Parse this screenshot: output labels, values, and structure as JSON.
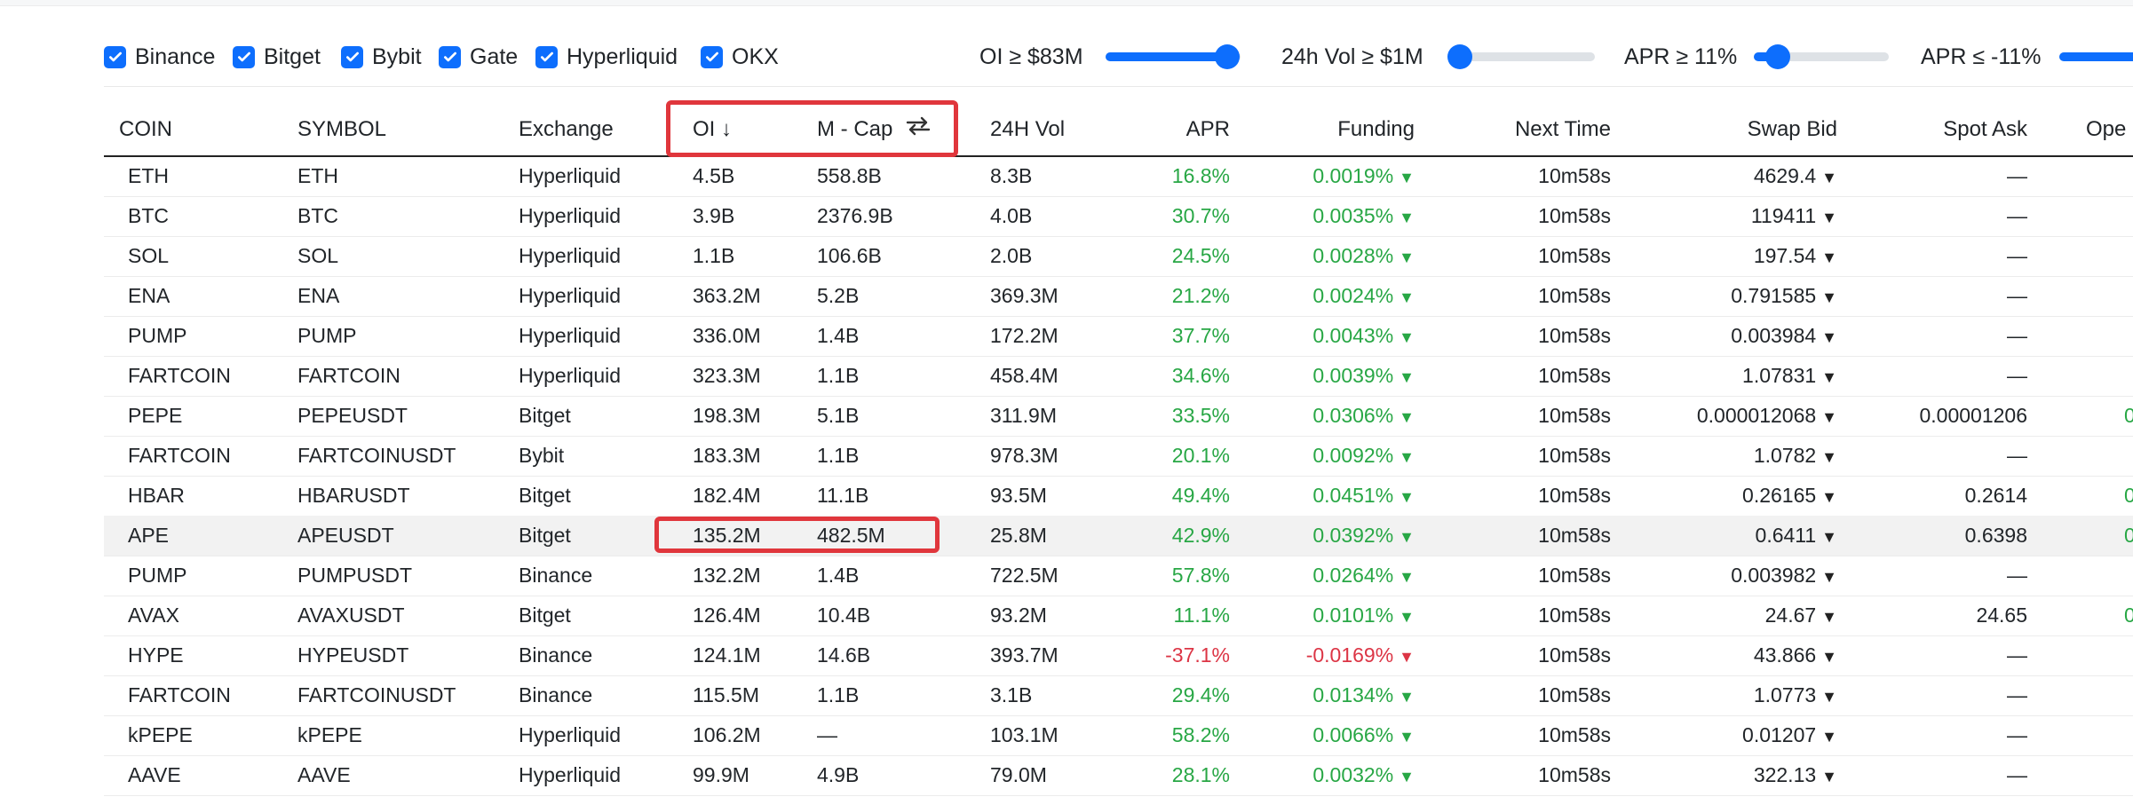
{
  "exchanges": [
    {
      "label": "Binance",
      "checked": true
    },
    {
      "label": "Bitget",
      "checked": true
    },
    {
      "label": "Bybit",
      "checked": true
    },
    {
      "label": "Gate",
      "checked": true
    },
    {
      "label": "Hyperliquid",
      "checked": true
    },
    {
      "label": "OKX",
      "checked": true
    }
  ],
  "filters": {
    "oi": {
      "label": "OI ≥ $83M",
      "level": 0.9
    },
    "vol": {
      "label": "24h Vol ≥ $1M",
      "level": 0.0
    },
    "apr_pos": {
      "label": "APR ≥ 11%",
      "level": 0.18
    },
    "apr_neg": {
      "label": "APR ≤ -11%",
      "level": 0.82
    }
  },
  "table": {
    "headers": {
      "coin": "COIN",
      "symbol": "SYMBOL",
      "exchange": "Exchange",
      "oi": "OI ↓",
      "mcap": "M - Cap",
      "vol": "24H Vol",
      "apr": "APR",
      "funding": "Funding",
      "next": "Next Time",
      "bid": "Swap Bid",
      "ask": "Spot Ask",
      "open": "Ope"
    },
    "rows": [
      {
        "coin": "ETH",
        "symbol": "ETH",
        "exchange": "Hyperliquid",
        "oi": "4.5B",
        "mcap": "558.8B",
        "vol": "8.3B",
        "apr": "16.8%",
        "funding": "0.0019%",
        "sign": "pos",
        "next": "10m58s",
        "bid": "4629.4",
        "ask": "—",
        "open": ""
      },
      {
        "coin": "BTC",
        "symbol": "BTC",
        "exchange": "Hyperliquid",
        "oi": "3.9B",
        "mcap": "2376.9B",
        "vol": "4.0B",
        "apr": "30.7%",
        "funding": "0.0035%",
        "sign": "pos",
        "next": "10m58s",
        "bid": "119411",
        "ask": "—",
        "open": ""
      },
      {
        "coin": "SOL",
        "symbol": "SOL",
        "exchange": "Hyperliquid",
        "oi": "1.1B",
        "mcap": "106.6B",
        "vol": "2.0B",
        "apr": "24.5%",
        "funding": "0.0028%",
        "sign": "pos",
        "next": "10m58s",
        "bid": "197.54",
        "ask": "—",
        "open": ""
      },
      {
        "coin": "ENA",
        "symbol": "ENA",
        "exchange": "Hyperliquid",
        "oi": "363.2M",
        "mcap": "5.2B",
        "vol": "369.3M",
        "apr": "21.2%",
        "funding": "0.0024%",
        "sign": "pos",
        "next": "10m58s",
        "bid": "0.791585",
        "ask": "—",
        "open": ""
      },
      {
        "coin": "PUMP",
        "symbol": "PUMP",
        "exchange": "Hyperliquid",
        "oi": "336.0M",
        "mcap": "1.4B",
        "vol": "172.2M",
        "apr": "37.7%",
        "funding": "0.0043%",
        "sign": "pos",
        "next": "10m58s",
        "bid": "0.003984",
        "ask": "—",
        "open": ""
      },
      {
        "coin": "FARTCOIN",
        "symbol": "FARTCOIN",
        "exchange": "Hyperliquid",
        "oi": "323.3M",
        "mcap": "1.1B",
        "vol": "458.4M",
        "apr": "34.6%",
        "funding": "0.0039%",
        "sign": "pos",
        "next": "10m58s",
        "bid": "1.07831",
        "ask": "—",
        "open": ""
      },
      {
        "coin": "PEPE",
        "symbol": "PEPEUSDT",
        "exchange": "Bitget",
        "oi": "198.3M",
        "mcap": "5.1B",
        "vol": "311.9M",
        "apr": "33.5%",
        "funding": "0.0306%",
        "sign": "pos",
        "next": "10m58s",
        "bid": "0.000012068",
        "ask": "0.00001206",
        "open": "0"
      },
      {
        "coin": "FARTCOIN",
        "symbol": "FARTCOINUSDT",
        "exchange": "Bybit",
        "oi": "183.3M",
        "mcap": "1.1B",
        "vol": "978.3M",
        "apr": "20.1%",
        "funding": "0.0092%",
        "sign": "pos",
        "next": "10m58s",
        "bid": "1.0782",
        "ask": "—",
        "open": ""
      },
      {
        "coin": "HBAR",
        "symbol": "HBARUSDT",
        "exchange": "Bitget",
        "oi": "182.4M",
        "mcap": "11.1B",
        "vol": "93.5M",
        "apr": "49.4%",
        "funding": "0.0451%",
        "sign": "pos",
        "next": "10m58s",
        "bid": "0.26165",
        "ask": "0.2614",
        "open": "0"
      },
      {
        "coin": "APE",
        "symbol": "APEUSDT",
        "exchange": "Bitget",
        "oi": "135.2M",
        "mcap": "482.5M",
        "vol": "25.8M",
        "apr": "42.9%",
        "funding": "0.0392%",
        "sign": "pos",
        "next": "10m58s",
        "bid": "0.6411",
        "ask": "0.6398",
        "open": "0"
      },
      {
        "coin": "PUMP",
        "symbol": "PUMPUSDT",
        "exchange": "Binance",
        "oi": "132.2M",
        "mcap": "1.4B",
        "vol": "722.5M",
        "apr": "57.8%",
        "funding": "0.0264%",
        "sign": "pos",
        "next": "10m58s",
        "bid": "0.003982",
        "ask": "—",
        "open": ""
      },
      {
        "coin": "AVAX",
        "symbol": "AVAXUSDT",
        "exchange": "Bitget",
        "oi": "126.4M",
        "mcap": "10.4B",
        "vol": "93.2M",
        "apr": "11.1%",
        "funding": "0.0101%",
        "sign": "pos",
        "next": "10m58s",
        "bid": "24.67",
        "ask": "24.65",
        "open": "0"
      },
      {
        "coin": "HYPE",
        "symbol": "HYPEUSDT",
        "exchange": "Binance",
        "oi": "124.1M",
        "mcap": "14.6B",
        "vol": "393.7M",
        "apr": "-37.1%",
        "funding": "-0.0169%",
        "sign": "neg",
        "next": "10m58s",
        "bid": "43.866",
        "ask": "—",
        "open": ""
      },
      {
        "coin": "FARTCOIN",
        "symbol": "FARTCOINUSDT",
        "exchange": "Binance",
        "oi": "115.5M",
        "mcap": "1.1B",
        "vol": "3.1B",
        "apr": "29.4%",
        "funding": "0.0134%",
        "sign": "pos",
        "next": "10m58s",
        "bid": "1.0773",
        "ask": "—",
        "open": ""
      },
      {
        "coin": "kPEPE",
        "symbol": "kPEPE",
        "exchange": "Hyperliquid",
        "oi": "106.2M",
        "mcap": "—",
        "vol": "103.1M",
        "apr": "58.2%",
        "funding": "0.0066%",
        "sign": "pos",
        "next": "10m58s",
        "bid": "0.01207",
        "ask": "—",
        "open": ""
      },
      {
        "coin": "AAVE",
        "symbol": "AAVE",
        "exchange": "Hyperliquid",
        "oi": "99.9M",
        "mcap": "4.9B",
        "vol": "79.0M",
        "apr": "28.1%",
        "funding": "0.0032%",
        "sign": "pos",
        "next": "10m58s",
        "bid": "322.13",
        "ask": "—",
        "open": ""
      }
    ]
  },
  "colors": {
    "accent": "#0d6efd",
    "positive": "#28a745",
    "negative": "#dc3545",
    "highlight": "#e0363c"
  },
  "icons": {
    "checkbox": "checkmark-icon",
    "swap": "swap-arrows-icon",
    "trend": "triangle-down-icon"
  }
}
